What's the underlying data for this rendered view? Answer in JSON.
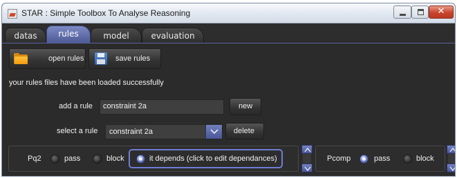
{
  "window": {
    "title": "STAR : Simple Toolbox To Analyse Reasoning",
    "controls": [
      "minimize",
      "maximize",
      "close"
    ]
  },
  "tabs": [
    {
      "label": "datas",
      "active": false
    },
    {
      "label": "rules",
      "active": true
    },
    {
      "label": "model",
      "active": false
    },
    {
      "label": "evaluation",
      "active": false
    }
  ],
  "toolbar": {
    "open_label": "open rules",
    "open_icon": "folder-icon",
    "save_label": "save rules",
    "save_icon": "floppy-disk-icon"
  },
  "status": "your rules files have been loaded successfully",
  "add_rule": {
    "label": "add a rule",
    "value": "constraint 2a",
    "button": "new"
  },
  "select_rule": {
    "label": "select a rule",
    "selected": "constraint 2a",
    "button": "delete"
  },
  "rules": [
    {
      "name": "Pq2",
      "options": [
        {
          "label": "pass",
          "selected": false
        },
        {
          "label": "block",
          "selected": false
        },
        {
          "label": "it depends (click to edit dependances)",
          "selected": true
        }
      ]
    },
    {
      "name": "Pcomp",
      "options": [
        {
          "label": "pass",
          "selected": true
        },
        {
          "label": "block",
          "selected": false
        }
      ]
    }
  ],
  "colors": {
    "background": "#2b2b2b",
    "accent": "#6f7dd6",
    "text": "#f2f2f2"
  }
}
